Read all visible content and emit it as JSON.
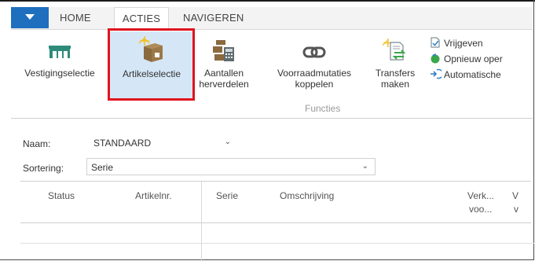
{
  "tabs": {
    "home": "HOME",
    "acties": "ACTIES",
    "navigeren": "NAVIGEREN"
  },
  "ribbon": {
    "buttons": [
      {
        "label": "Vestigingselectie",
        "icon": "warehouse-icon"
      },
      {
        "label": "Artikelselectie",
        "icon": "new-item-box-icon",
        "selected": true
      },
      {
        "label_line1": "Aantallen",
        "label_line2": "herverdelen",
        "icon": "distribute-calculator-icon"
      },
      {
        "label_line1": "Voorraadmutaties",
        "label_line2": "koppelen",
        "icon": "link-icon"
      },
      {
        "label_line1": "Transfers",
        "label_line2": "maken",
        "icon": "new-transfer-icon"
      }
    ],
    "group_label": "Functies",
    "small_items": [
      {
        "label": "Vrijgeven",
        "icon": "release-document-icon"
      },
      {
        "label": "Opnieuw oper",
        "icon": "reopen-icon"
      },
      {
        "label": "Automatische",
        "icon": "arrow-in-icon"
      }
    ]
  },
  "filters": {
    "naam_label": "Naam:",
    "naam_value": "STANDAARD",
    "sortering_label": "Sortering:",
    "sortering_value": "Serie"
  },
  "grid": {
    "columns": [
      "Status",
      "Artikelnr.",
      "Serie",
      "Omschrijving",
      "Verk...",
      "voo...",
      "V",
      "v"
    ]
  },
  "colors": {
    "accent": "#1f6fbf",
    "selection": "#d5e7f7",
    "highlight": "#e0141e",
    "icon_teal": "#2e8b7a",
    "icon_brown": "#8a6a3e"
  }
}
